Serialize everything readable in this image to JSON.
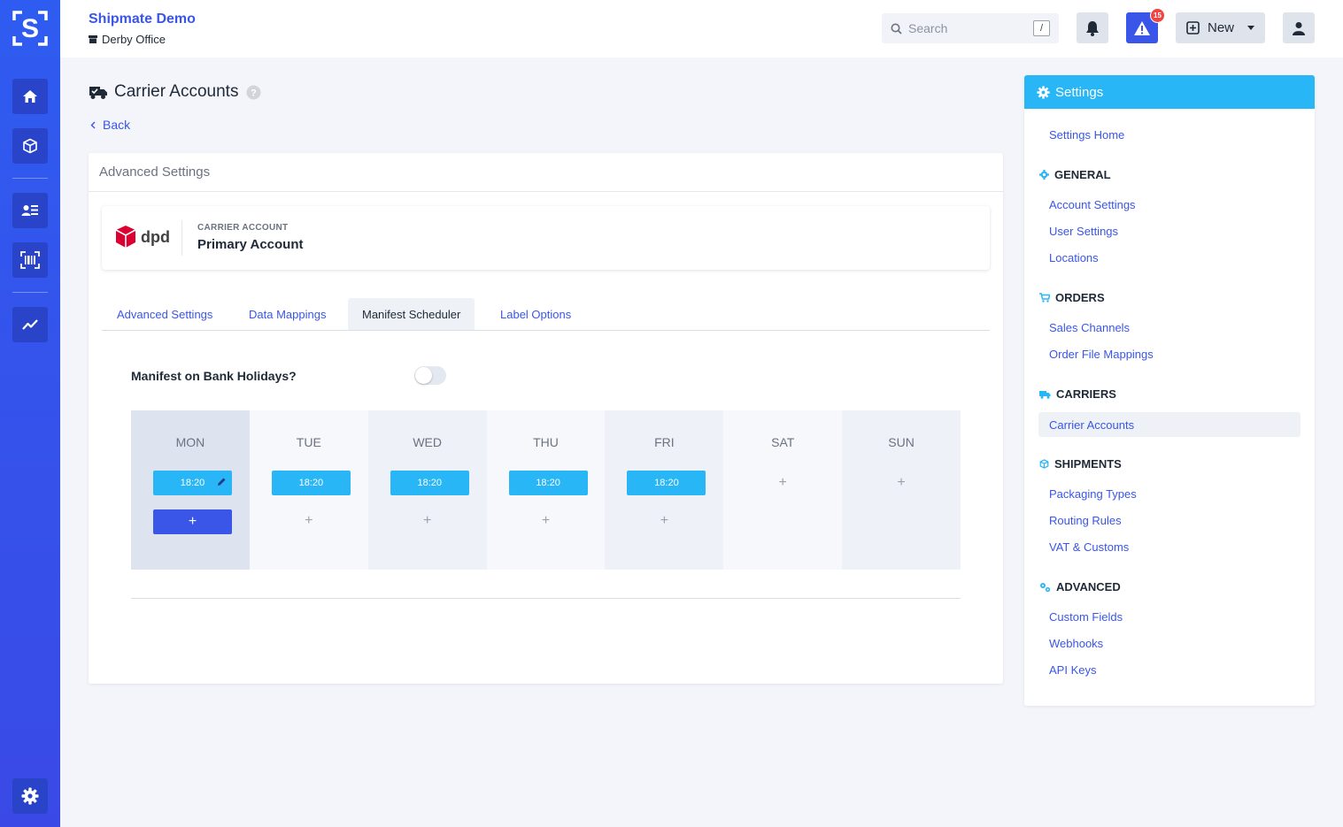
{
  "app": {
    "brand": "Shipmate Demo",
    "office": "Derby Office",
    "search_placeholder": "Search",
    "search_shortcut": "/",
    "alert_count": "15",
    "new_label": "New"
  },
  "page": {
    "title": "Carrier Accounts",
    "back_label": "Back"
  },
  "card": {
    "header": "Advanced Settings",
    "carrier_logo_text": "dpd",
    "carrier_caption": "CARRIER ACCOUNT",
    "carrier_account_name": "Primary Account",
    "tabs": [
      {
        "label": "Advanced Settings",
        "active": false
      },
      {
        "label": "Data Mappings",
        "active": false
      },
      {
        "label": "Manifest Scheduler",
        "active": true
      },
      {
        "label": "Label Options",
        "active": false
      }
    ],
    "bank_holiday_label": "Manifest on Bank Holidays?",
    "bank_holiday_enabled": false,
    "days": [
      {
        "name": "MON",
        "time": "18:20",
        "selected": true
      },
      {
        "name": "TUE",
        "time": "18:20",
        "selected": false
      },
      {
        "name": "WED",
        "time": "18:20",
        "selected": false
      },
      {
        "name": "THU",
        "time": "18:20",
        "selected": false
      },
      {
        "name": "FRI",
        "time": "18:20",
        "selected": false
      },
      {
        "name": "SAT",
        "time": "",
        "selected": false
      },
      {
        "name": "SUN",
        "time": "",
        "selected": false
      }
    ],
    "add_symbol": "+"
  },
  "settings": {
    "title": "Settings",
    "home": "Settings Home",
    "general": {
      "title": "GENERAL",
      "items": [
        "Account Settings",
        "User Settings",
        "Locations"
      ]
    },
    "orders": {
      "title": "ORDERS",
      "items": [
        "Sales Channels",
        "Order File Mappings"
      ]
    },
    "carriers": {
      "title": "CARRIERS",
      "items": [
        "Carrier Accounts"
      ]
    },
    "shipments": {
      "title": "SHIPMENTS",
      "items": [
        "Packaging Types",
        "Routing Rules",
        "VAT & Customs"
      ]
    },
    "advanced": {
      "title": "ADVANCED",
      "items": [
        "Custom Fields",
        "Webhooks",
        "API Keys"
      ]
    }
  },
  "colors": {
    "rail": "#2f5cf0",
    "accent": "#3a56e8",
    "cyan": "#29b6f6",
    "alert": "#ef4444",
    "dpd_red": "#dc0032"
  }
}
